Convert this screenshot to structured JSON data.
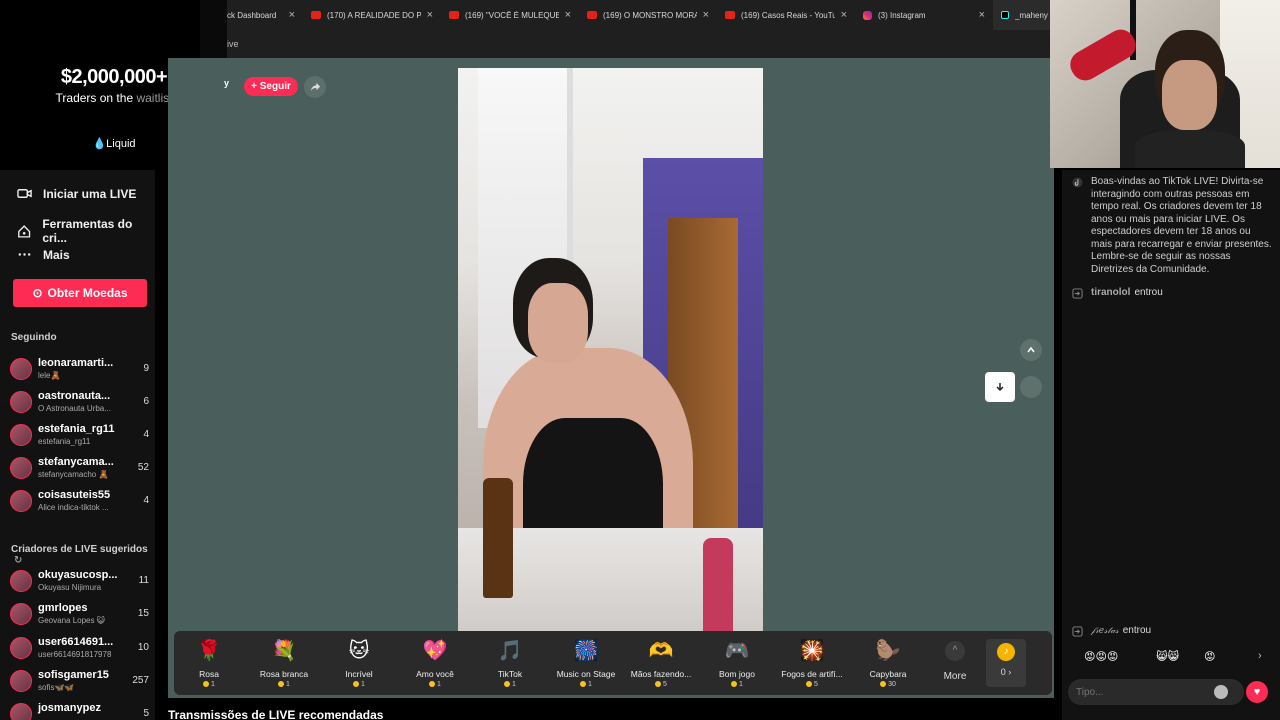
{
  "tabs": [
    {
      "title": "ck Dashboard",
      "icon": "none"
    },
    {
      "title": "(170) A REALIDADE DO PÉ",
      "icon": "youtube"
    },
    {
      "title": "(169) \"VOCÊ É MULEQUE\"",
      "icon": "youtube"
    },
    {
      "title": "(169) O MONSTRO MORA",
      "icon": "youtube"
    },
    {
      "title": "(169) Casos Reais - YouTube",
      "icon": "youtube"
    },
    {
      "title": "(3) Instagram",
      "icon": "instagram"
    },
    {
      "title": "_maheny",
      "icon": "tiktok"
    }
  ],
  "address_fragment": "ive",
  "ad": {
    "amount": "$2,000,000+",
    "line_a": "Traders on the",
    "line_b": "waitlist",
    "brand": "Liquid"
  },
  "sidebar": {
    "nav": [
      {
        "label": "Iniciar uma LIVE",
        "icon": "camera-icon"
      },
      {
        "label": "Ferramentas do cri...",
        "icon": "home-icon"
      },
      {
        "label": "Mais",
        "icon": "more-icon"
      }
    ],
    "coins_button": "Obter Moedas",
    "following_title": "Seguindo",
    "following": [
      {
        "name": "leonaramarti...",
        "sub": "lele🧸",
        "count": "9"
      },
      {
        "name": "oastronauta...",
        "sub": "O Astronauta Urba...",
        "count": "6"
      },
      {
        "name": "estefania_rg11",
        "sub": "estefania_rg11",
        "count": "4"
      },
      {
        "name": "stefanycama...",
        "sub": "stefanycamacho 🧸",
        "count": "52"
      },
      {
        "name": "coisasuteis55",
        "sub": "Alice indica-tiktok ...",
        "count": "4"
      }
    ],
    "suggested_title": "Criadores de LIVE sugeridos",
    "suggested": [
      {
        "name": "okuyasucosp...",
        "sub": "Okuyasu Nijimura",
        "count": "11"
      },
      {
        "name": "gmrlopes",
        "sub": "Geovana Lopes 😺",
        "count": "15"
      },
      {
        "name": "user6614691...",
        "sub": "user6614691817978",
        "count": "10"
      },
      {
        "name": "sofisgamer15",
        "sub": "sofis🦋🦋",
        "count": "257"
      },
      {
        "name": "josmanypez",
        "sub": "",
        "count": "5"
      }
    ]
  },
  "stage": {
    "host_fragment": "y",
    "follow_label": "+ Seguir"
  },
  "gifts": [
    {
      "name": "Rosa",
      "price": "1",
      "icon": "🌹"
    },
    {
      "name": "Rosa branca",
      "price": "1",
      "icon": "💐"
    },
    {
      "name": "Incrível",
      "price": "1",
      "icon": "🐱"
    },
    {
      "name": "Amo você",
      "price": "1",
      "icon": "💖"
    },
    {
      "name": "TikTok",
      "price": "1",
      "icon": "🎵"
    },
    {
      "name": "Music on Stage",
      "price": "1",
      "icon": "🎆"
    },
    {
      "name": "Mãos fazendo...",
      "price": "5",
      "icon": "🫶"
    },
    {
      "name": "Bom jogo",
      "price": "1",
      "icon": "🎮"
    },
    {
      "name": "Fogos de artifí...",
      "price": "5",
      "icon": "🎇"
    },
    {
      "name": "Capybara",
      "price": "30",
      "icon": "🦫"
    }
  ],
  "more_label": "More",
  "coin_balance": "0 ›",
  "recommended_title": "Transmissões de LIVE recomendadas",
  "chat": {
    "welcome": "Boas-vindas ao TikTok LIVE! Divirta-se interagindo com outras pessoas em tempo real. Os criadores devem ter 18 anos ou mais para iniciar LIVE. Os espectadores devem ter 18 anos ou mais para recarregar e enviar presentes. Lembre-se de seguir as nossas Diretrizes da Comunidade.",
    "joins": [
      {
        "user": "tiranolol",
        "action": "entrou"
      },
      {
        "user": "𝒻𝓇𝑒𝓈𝓉𝒶𝓈",
        "action": "entrou"
      }
    ],
    "quick_emojis": [
      "😡😡😡",
      "😸😸",
      "😡"
    ],
    "input_placeholder": "Tipo..."
  },
  "colors": {
    "accent": "#fe2c55",
    "stage_bg": "#4a5f5b",
    "coin": "#f7c21a"
  }
}
